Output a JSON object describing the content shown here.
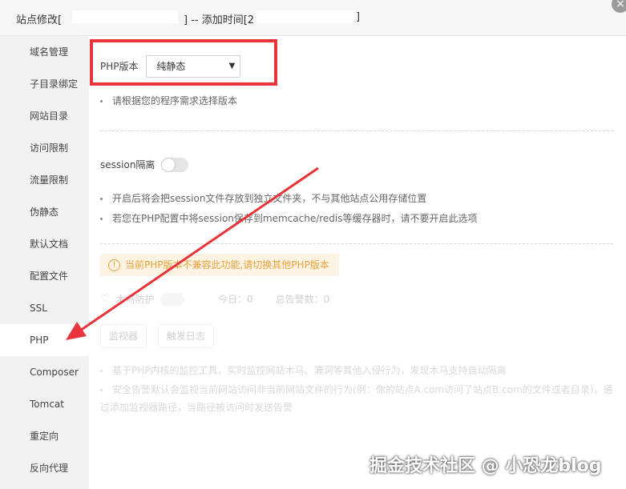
{
  "title": {
    "prefix": "站点修改[",
    "mid": "] -- 添加时间[",
    "mid_tail": "2",
    "suffix": "]",
    "close": "×"
  },
  "sidebar": {
    "items": [
      {
        "label": "域名管理"
      },
      {
        "label": "子目录绑定"
      },
      {
        "label": "网站目录"
      },
      {
        "label": "访问限制"
      },
      {
        "label": "流量限制"
      },
      {
        "label": "伪静态"
      },
      {
        "label": "默认文档"
      },
      {
        "label": "配置文件"
      },
      {
        "label": "SSL"
      },
      {
        "label": "PHP"
      },
      {
        "label": "Composer"
      },
      {
        "label": "Tomcat"
      },
      {
        "label": "重定向"
      },
      {
        "label": "反向代理"
      }
    ],
    "active_index": 9
  },
  "php": {
    "label": "PHP版本",
    "selected": "纯静态",
    "hint": "请根据您的程序需求选择版本"
  },
  "session": {
    "label": "session隔离",
    "enabled": false,
    "hints": [
      "开启后将会把session文件存放到独立文件夹，不与其他站点公用存储位置",
      "若您在PHP配置中将session保存到memcache/redis等缓存器时，请不要开启此选项"
    ]
  },
  "warning": {
    "icon": "!",
    "text": "当前PHP版本不兼容此功能,请切换其他PHP版本"
  },
  "guard": {
    "label": "木马防护",
    "today": "今日：0",
    "total": "总告警数：0",
    "buttons": [
      "监视器",
      "触发日志"
    ],
    "notes": [
      "基于PHP内核的监控工具，实时监控网站木马、漏洞等其他入侵行为，发现木马支持自动隔离",
      "安全告警默认会监视当前网站访问非当前网站文件的行为(例：你的站点A.com访问了站点B.com的文件或者目录)，通过添加监视器路径，当路径被访问时发送告警"
    ]
  },
  "watermark": "掘金技术社区 @ 小恐龙blog",
  "colors": {
    "highlight": "#e8343a",
    "warning": "#e6a23c"
  }
}
